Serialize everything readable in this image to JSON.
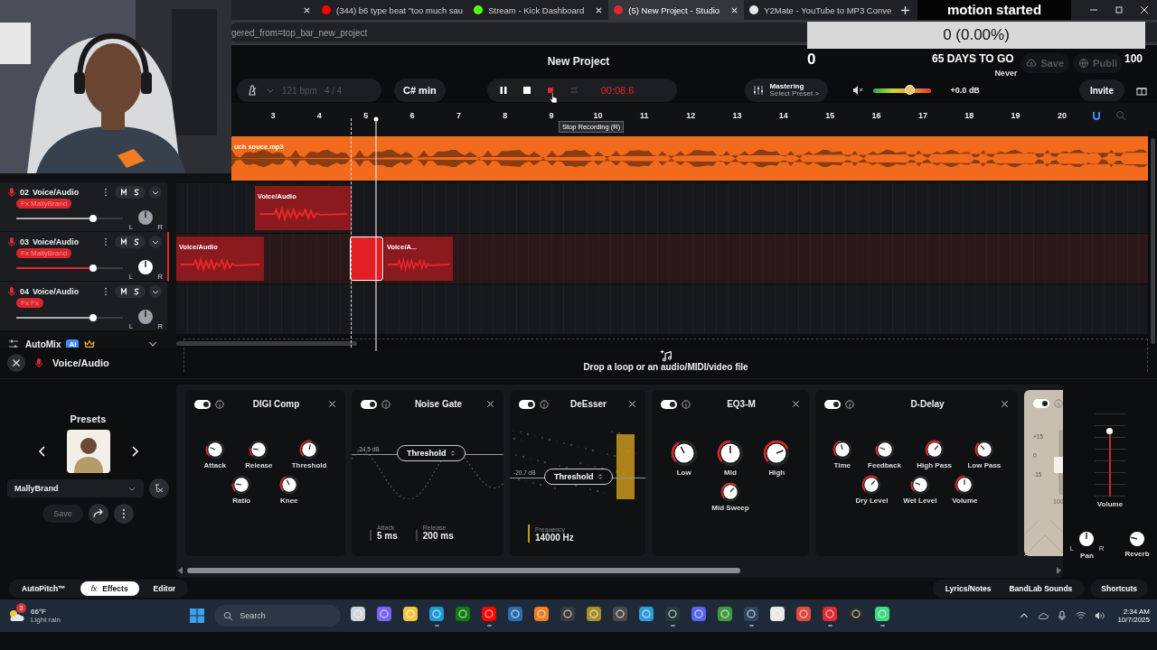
{
  "browser": {
    "tabs": [
      {
        "closable": true,
        "selected": false
      },
      {
        "title": "(344) b6 type beat \"too much sau",
        "color": "#ff0000",
        "closable": false,
        "selected": false
      },
      {
        "title": "Stream - Kick Dashboard",
        "color": "#53fc18",
        "closable": true,
        "selected": false
      },
      {
        "title": "(5) New Project - Studio",
        "color": "#e0282e",
        "closable": true,
        "selected": true
      },
      {
        "title": "Y2Mate - YouTube to MP3 Conve",
        "color": "#e8e8e8",
        "closable": false,
        "selected": false
      }
    ],
    "address": "gered_from=top_bar_new_project"
  },
  "project": {
    "title": "New Project",
    "last_saved": "Never",
    "save": "Save",
    "publish": "Publi"
  },
  "toolbar": {
    "bpm": "121 bpm",
    "time_signature": "4 / 4",
    "tempo_disabled": true,
    "key": "C# min",
    "recording": true,
    "time": "00:08.6",
    "mastering": "Mastering",
    "mastering_preset": "Select Preset >",
    "master_volume": {
      "level": 0.65
    },
    "gain": "+0.0 dB",
    "invite": "Invite",
    "tooltip": "Stop Recording (R)"
  },
  "ruler": [
    "3",
    "4",
    "5",
    "6",
    "7",
    "8",
    "9",
    "10",
    "11",
    "12",
    "13",
    "14",
    "15",
    "16",
    "17",
    "18",
    "19",
    "20"
  ],
  "tracks": [
    {
      "kind": "loop",
      "clips": [
        {
          "label": "uch souce.mp3"
        }
      ]
    },
    {
      "kind": "voice",
      "number": "02",
      "name": "Voice/Audio",
      "fx": "Fx MallyBrand",
      "selected": false,
      "volume": {
        "level": 0.72
      },
      "pan": {
        "left": "L",
        "right": "R"
      },
      "clips": [
        {
          "label": "Voice/Audio",
          "recording": false
        }
      ]
    },
    {
      "kind": "voice",
      "number": "03",
      "name": "Voice/Audio",
      "fx": "Fx MallyBrand",
      "selected": true,
      "volume": {
        "level": 0.72
      },
      "pan": {
        "left": "L",
        "right": "R"
      },
      "clips": [
        {
          "label": "Voice/Audio",
          "recording": false
        },
        {
          "recording": true
        },
        {
          "label": "Voice/A...",
          "recording": false
        }
      ]
    },
    {
      "kind": "voice",
      "number": "04",
      "name": "Voice/Audio",
      "fx": "Fx Fx",
      "selected": false,
      "volume": {
        "level": 0.72
      },
      "pan": {
        "left": "L",
        "right": "R"
      }
    }
  ],
  "automix": {
    "label": "AutoMix",
    "badge": "AI"
  },
  "drop_zone": "Drop a loop or an audio/MIDI/video file",
  "panel": {
    "title": "Voice/Audio",
    "presets": {
      "title": "Presets",
      "name": "MallyBrand",
      "save": "Save",
      "save_disabled": true
    },
    "effects": [
      {
        "kind": "knobs",
        "name": "DIGI Comp",
        "on": true,
        "rows": [
          {
            "knobs": [
              {
                "label": "Attack"
              },
              {
                "label": "Release"
              },
              {
                "label": "Threshold"
              }
            ]
          },
          {
            "knobs": [
              {
                "label": "Ratio"
              },
              {
                "label": "Knee"
              }
            ]
          }
        ]
      },
      {
        "kind": "gate",
        "name": "Noise Gate",
        "on": true,
        "reading": "-24.5 dB",
        "control": "Threshold",
        "params": [
          {
            "label": "Attack",
            "value": "5 ms"
          },
          {
            "label": "Release",
            "value": "200 ms"
          }
        ]
      },
      {
        "kind": "deesser",
        "name": "DeEsser",
        "on": true,
        "reading": "-20.7 dB",
        "control": "Threshold",
        "params": [
          {
            "label": "Frequency",
            "value": "14000 Hz"
          }
        ]
      },
      {
        "kind": "eq",
        "name": "EQ3-M",
        "on": true,
        "rows": [
          {
            "knobs": [
              {
                "label": "Low"
              },
              {
                "label": "Mid"
              },
              {
                "label": "High"
              }
            ]
          },
          {
            "knobs": [
              {
                "label": "Mid Sweep"
              }
            ]
          }
        ]
      },
      {
        "kind": "knobs",
        "name": "D-Delay",
        "on": true,
        "rows": [
          {
            "knobs": [
              {
                "label": "Time"
              },
              {
                "label": "Feedback"
              },
              {
                "label": "High Pass"
              },
              {
                "label": "Low Pass"
              }
            ]
          },
          {
            "knobs": [
              {
                "label": "Dry Level"
              },
              {
                "label": "Wet Level"
              },
              {
                "label": "Volume"
              }
            ]
          }
        ]
      },
      {
        "kind": "amp",
        "on": true,
        "scale": [
          "+15",
          "0",
          "-15"
        ],
        "reading": "100",
        "fader": {
          "level": 0.45
        }
      }
    ],
    "volume": {
      "label": "Volume",
      "level": 0.78
    },
    "pan": {
      "label": "Pan",
      "left": "L",
      "right": "R"
    },
    "reverb": {
      "label": "Reverb"
    }
  },
  "footer": {
    "tabs": [
      {
        "label": "AutoPitch™",
        "selected": false
      },
      {
        "prefix": "fx",
        "label": "Effects",
        "selected": true
      },
      {
        "label": "Editor",
        "selected": false
      }
    ],
    "links": [
      "Lyrics/Notes",
      "BandLab Sounds",
      "Shortcuts"
    ]
  },
  "taskbar": {
    "temperature": "66°F",
    "weather": "Light rain",
    "badge": "3",
    "search": {
      "placeholder": "Search"
    },
    "apps": [
      {
        "color": "#cfd3d8",
        "open": false
      },
      {
        "color": "#7b61ff",
        "open": false
      },
      {
        "color": "#f5c542",
        "open": false
      },
      {
        "color": "#1e9bd7",
        "open": true
      },
      {
        "color": "#107c10",
        "open": false
      },
      {
        "color": "#ff0000",
        "open": true
      },
      {
        "color": "#2b6cb0",
        "open": false
      },
      {
        "color": "#f07d23",
        "open": false
      },
      {
        "color": "#3a3a3e",
        "open": false
      },
      {
        "color": "#a98f2a",
        "open": false
      },
      {
        "color": "#4a4a4a",
        "open": false
      },
      {
        "color": "#2d9cdb",
        "open": false
      },
      {
        "color": "#1f3b38",
        "open": true
      },
      {
        "color": "#5865f2",
        "open": false
      },
      {
        "color": "#3f9b3f",
        "open": false
      },
      {
        "color": "#2a475e",
        "open": true
      },
      {
        "color": "#e8e8e8",
        "open": false
      },
      {
        "color": "#e04a3a",
        "open": false
      },
      {
        "color": "#e0282e",
        "open": true
      },
      {
        "color": "#2a2a2a",
        "open": false
      },
      {
        "color": "#3ddc84",
        "open": true
      }
    ],
    "time": "2:34 AM",
    "date": "10/7/2025"
  },
  "overlay": {
    "alert": "motion started",
    "goal": "0 (0.00%)",
    "current": "0",
    "countdown": "65 DAYS TO GO",
    "target": "100"
  }
}
